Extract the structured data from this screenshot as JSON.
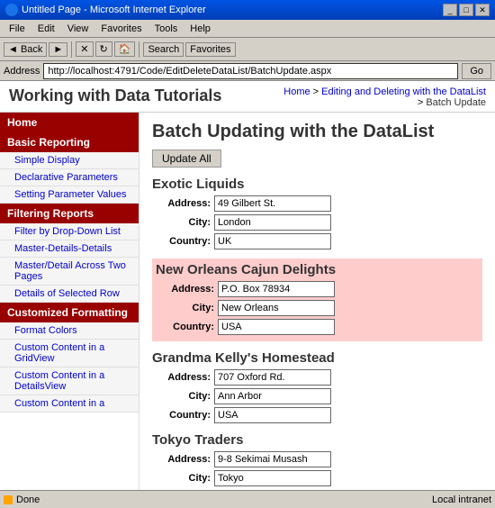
{
  "window": {
    "title": "Untitled Page - Microsoft Internet Explorer",
    "title_icon": "ie-icon"
  },
  "menu": {
    "items": [
      "File",
      "Edit",
      "View",
      "Favorites",
      "Tools",
      "Help"
    ]
  },
  "toolbar": {
    "back_label": "◄ Back",
    "forward_label": "►",
    "stop_label": "✕",
    "refresh_label": "↻",
    "home_label": "🏠",
    "search_label": "Search",
    "favorites_label": "Favorites"
  },
  "address_bar": {
    "label": "Address",
    "value": "http://localhost:4791/Code/EditDeleteDataList/BatchUpdate.aspx",
    "go_label": "Go"
  },
  "breadcrumb": {
    "home": "Home",
    "parent": "Editing and Deleting with the DataList",
    "current": "Batch Update"
  },
  "page_header": {
    "site_title": "Working with Data Tutorials"
  },
  "content": {
    "title": "Batch Updating with the DataList",
    "update_all_button": "Update All",
    "companies": [
      {
        "name": "Exotic Liquids",
        "highlighted": false,
        "address": "49 Gilbert St.",
        "city": "London",
        "country": "UK"
      },
      {
        "name": "New Orleans Cajun Delights",
        "highlighted": true,
        "address": "P.O. Box 78934",
        "city": "New Orleans",
        "country": "USA"
      },
      {
        "name": "Grandma Kelly's Homestead",
        "highlighted": false,
        "address": "707 Oxford Rd.",
        "city": "Ann Arbor",
        "country": "USA"
      },
      {
        "name": "Tokyo Traders",
        "highlighted": false,
        "address": "9-8 Sekimai Musash",
        "city": "Tokyo",
        "country": ""
      }
    ]
  },
  "sidebar": {
    "sections": [
      {
        "label": "Home",
        "type": "header-only",
        "is_home": true
      },
      {
        "label": "Basic Reporting",
        "items": [
          "Simple Display",
          "Declarative Parameters",
          "Setting Parameter Values"
        ]
      },
      {
        "label": "Filtering Reports",
        "items": [
          "Filter by Drop-Down List",
          "Master-Details-Details",
          "Master/Detail Across Two Pages",
          "Details of Selected Row"
        ]
      },
      {
        "label": "Customized Formatting",
        "items": [
          "Format Colors",
          "Custom Content in a GridView",
          "Custom Content in a DetailsView",
          "Custom Content in a"
        ]
      }
    ]
  },
  "status_bar": {
    "left": "Done",
    "right": "Local intranet"
  }
}
